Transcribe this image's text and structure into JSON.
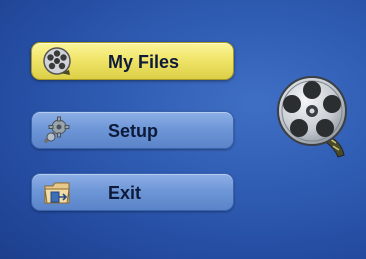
{
  "menu": {
    "items": [
      {
        "label": "My Files",
        "icon": "film-reel-icon",
        "selected": true
      },
      {
        "label": "Setup",
        "icon": "gears-icon",
        "selected": false
      },
      {
        "label": "Exit",
        "icon": "folder-exit-icon",
        "selected": false
      }
    ]
  },
  "logo": {
    "icon": "film-reel-logo-icon"
  },
  "colors": {
    "background": "#2f5cb3",
    "selected_button": "#f0e56a",
    "normal_button": "#6f97d8",
    "label_text": "#0d1a3a"
  }
}
